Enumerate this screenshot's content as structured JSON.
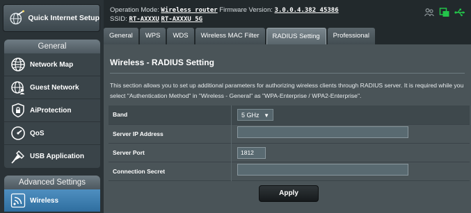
{
  "sidebar": {
    "quick_setup": "Quick Internet Setup",
    "general_header": "General",
    "general_items": [
      "Network Map",
      "Guest Network",
      "AiProtection",
      "QoS",
      "USB Application"
    ],
    "advanced_header": "Advanced Settings",
    "advanced_items": [
      "Wireless"
    ]
  },
  "topbar": {
    "mode_label": "Operation Mode:",
    "mode_value": "Wireless router",
    "fw_label": "Firmware Version:",
    "fw_value": "3.0.0.4.382_45386",
    "ssid_label": "SSID:",
    "ssid_1": "RT-AXXXU",
    "ssid_2": "RT-AXXXU_5G"
  },
  "tabs": [
    "General",
    "WPS",
    "WDS",
    "Wireless MAC Filter",
    "RADIUS Setting",
    "Professional"
  ],
  "active_tab": "RADIUS Setting",
  "page": {
    "title": "Wireless - RADIUS Setting",
    "description": "This section allows you to set up additional parameters for authorizing wireless clients through RADIUS server. It is required while you select \"Authentication Method\" in \"Wireless - General\" as \"WPA-Enterprise / WPA2-Enterprise\"."
  },
  "form": {
    "band_label": "Band",
    "band_value": "5 GHz",
    "server_ip_label": "Server IP Address",
    "server_ip_value": "",
    "server_port_label": "Server Port",
    "server_port_value": "1812",
    "secret_label": "Connection Secret",
    "secret_value": ""
  },
  "apply_label": "Apply",
  "colors": {
    "active_tab": "#7a868d",
    "active_menu": "#3a7fb3",
    "background": "#22292c"
  }
}
